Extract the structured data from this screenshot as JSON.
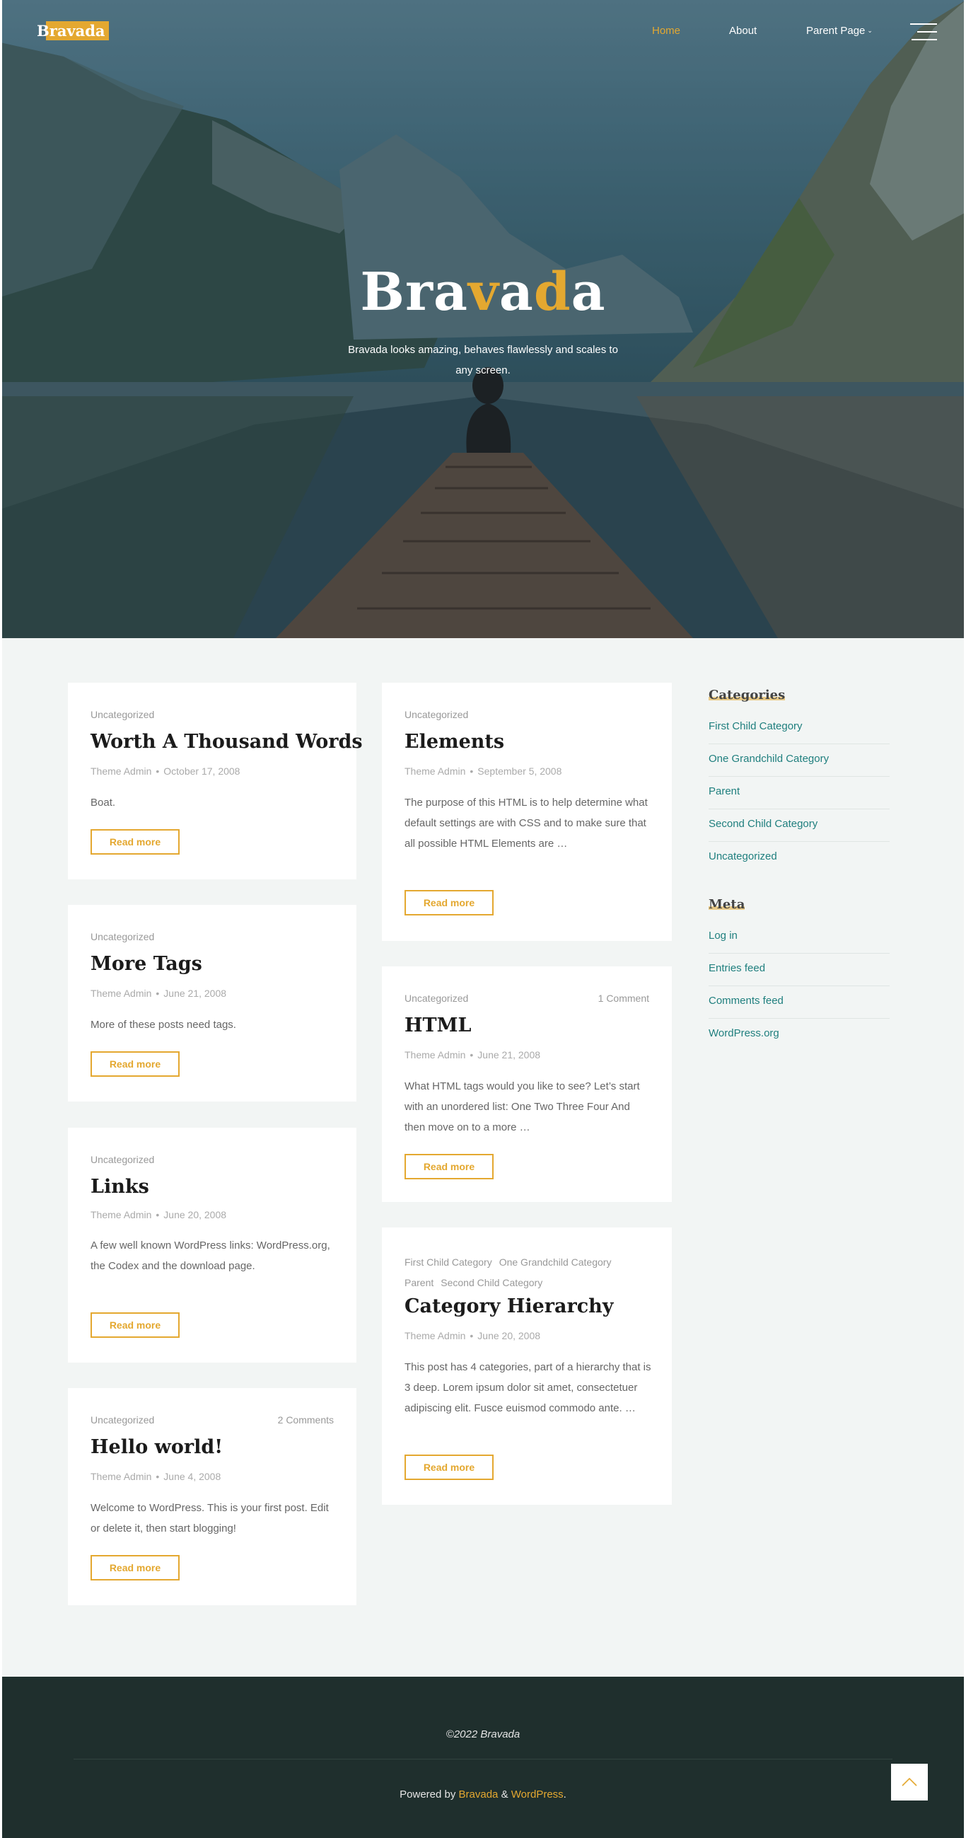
{
  "site": {
    "logo": "Bravada",
    "hero_title_parts": [
      "Bra",
      "v",
      "a",
      "d",
      "a"
    ],
    "hero_subtitle": "Bravada looks amazing, behaves flawlessly and scales to any screen."
  },
  "nav": {
    "items": [
      {
        "label": "Home",
        "active": true
      },
      {
        "label": "About",
        "active": false
      },
      {
        "label": "Parent Page",
        "active": false,
        "has_dropdown": true
      }
    ],
    "menu_icon": "hamburger-icon"
  },
  "posts": [
    {
      "category": "Uncategorized",
      "title": "Worth A Thousand Words",
      "author": "Theme Admin",
      "date": "October 17, 2008",
      "excerpt": "Boat.",
      "button": "Read more"
    },
    {
      "category": "Uncategorized",
      "title": "More Tags",
      "author": "Theme Admin",
      "date": "June 21, 2008",
      "excerpt": "More of these posts need tags.",
      "button": "Read more"
    },
    {
      "category": "Uncategorized",
      "title": "Links",
      "author": "Theme Admin",
      "date": "June 20, 2008",
      "excerpt": "A few well known WordPress links: WordPress.org, the Codex and the download page.",
      "button": "Read more"
    },
    {
      "category": "Uncategorized",
      "comments": "2 Comments",
      "title": "Hello world!",
      "author": "Theme Admin",
      "date": "June 4, 2008",
      "excerpt": "Welcome to WordPress. This is your first post. Edit or delete it, then start blogging!",
      "button": "Read more"
    },
    {
      "category": "Uncategorized",
      "title": "Elements",
      "author": "Theme Admin",
      "date": "September 5, 2008",
      "excerpt": "The purpose of this HTML is to help determine what default settings are with CSS and to make sure that all possible HTML Elements are …",
      "button": "Read more"
    },
    {
      "category": "Uncategorized",
      "comments": "1 Comment",
      "title": "HTML",
      "author": "Theme Admin",
      "date": "June 21, 2008",
      "excerpt": "What HTML tags would you like to see? Let’s start with an unordered list: One Two Three Four And then move on to a more …",
      "button": "Read more"
    },
    {
      "categories": [
        "First Child Category",
        "One Grandchild Category",
        "Parent",
        "Second Child Category"
      ],
      "title": "Category Hierarchy",
      "author": "Theme Admin",
      "date": "June 20, 2008",
      "excerpt": "This post has 4 categories, part of a hierarchy that is 3 deep. Lorem ipsum dolor sit amet, consectetuer adipiscing elit. Fusce euismod commodo ante. …",
      "button": "Read more"
    }
  ],
  "sidebar": {
    "categories_title": "Categories",
    "categories": [
      "First Child Category",
      "One Grandchild Category",
      "Parent",
      "Second Child Category",
      "Uncategorized"
    ],
    "meta_title": "Meta",
    "meta": [
      "Log in",
      "Entries feed",
      "Comments feed",
      "WordPress.org"
    ]
  },
  "footer": {
    "copyright": "©2022 Bravada",
    "powered_prefix": "Powered by ",
    "powered_theme": "Bravada",
    "powered_sep": " & ",
    "powered_platform": "WordPress",
    "powered_suffix": "."
  },
  "colors": {
    "accent": "#e4a830",
    "link": "#1f7f7e",
    "footer_bg": "#1f2f2d",
    "page_bg": "#f2f5f4"
  },
  "icons": {
    "back_to_top": "chevron-up-icon",
    "dropdown": "chevron-down-icon"
  }
}
